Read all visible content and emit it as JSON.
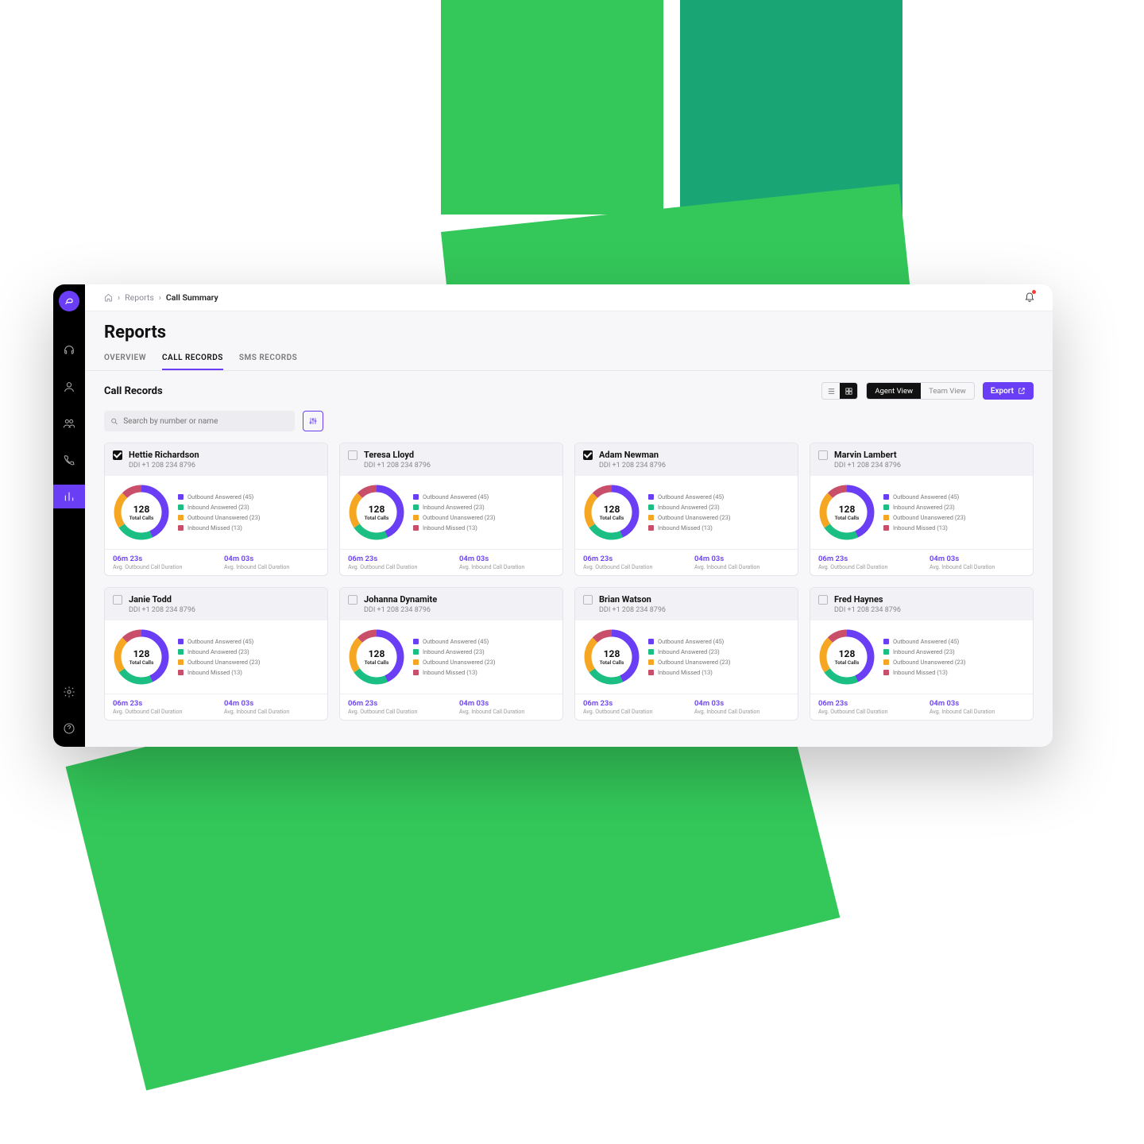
{
  "breadcrumb": {
    "root": "Reports",
    "current": "Call Summary"
  },
  "page_title": "Reports",
  "tabs": {
    "overview": "OVERVIEW",
    "call_records": "CALL RECORDS",
    "sms_records": "SMS RECORDS",
    "active": "call_records"
  },
  "section_title": "Call Records",
  "segments": {
    "agent": "Agent View",
    "team": "Team View",
    "active": "agent"
  },
  "export_label": "Export",
  "search_placeholder": "Search by number or name",
  "legend_colors": {
    "outbound_answered": "#6a3ef5",
    "inbound_answered": "#1bbf83",
    "outbound_unanswered": "#f5a623",
    "inbound_missed": "#c84e6a"
  },
  "legend_labels": {
    "outbound_answered": "Outbound Answered (45)",
    "inbound_answered": "Inbound Answered (23)",
    "outbound_unanswered": "Outbound Unanswered (23)",
    "inbound_missed": "Inbound Missed (13)"
  },
  "donut": {
    "total": "128",
    "total_label": "Total Calls",
    "segments": [
      {
        "key": "outbound_answered",
        "value": 45
      },
      {
        "key": "inbound_answered",
        "value": 23
      },
      {
        "key": "outbound_unanswered",
        "value": 23
      },
      {
        "key": "inbound_missed",
        "value": 13
      }
    ]
  },
  "metrics": {
    "outbound_dur": {
      "value": "06m 23s",
      "label": "Avg. Outbound Call Duration"
    },
    "inbound_dur": {
      "value": "04m 03s",
      "label": "Avg. Inbound Call Duration"
    }
  },
  "records": [
    {
      "name": "Hettie Richardson",
      "ddi": "DDI +1 208 234 8796",
      "checked": true
    },
    {
      "name": "Teresa Lloyd",
      "ddi": "DDI +1 208 234 8796",
      "checked": false
    },
    {
      "name": "Adam Newman",
      "ddi": "DDI +1 208 234 8796",
      "checked": true
    },
    {
      "name": "Marvin Lambert",
      "ddi": "DDI +1 208 234 8796",
      "checked": false
    },
    {
      "name": "Janie Todd",
      "ddi": "DDI +1 208 234 8796",
      "checked": false
    },
    {
      "name": "Johanna Dynamite",
      "ddi": "DDI +1 208 234 8796",
      "checked": false
    },
    {
      "name": "Brian Watson",
      "ddi": "DDI +1 208 234 8796",
      "checked": false
    },
    {
      "name": "Fred Haynes",
      "ddi": "DDI +1 208 234 8796",
      "checked": false
    }
  ]
}
